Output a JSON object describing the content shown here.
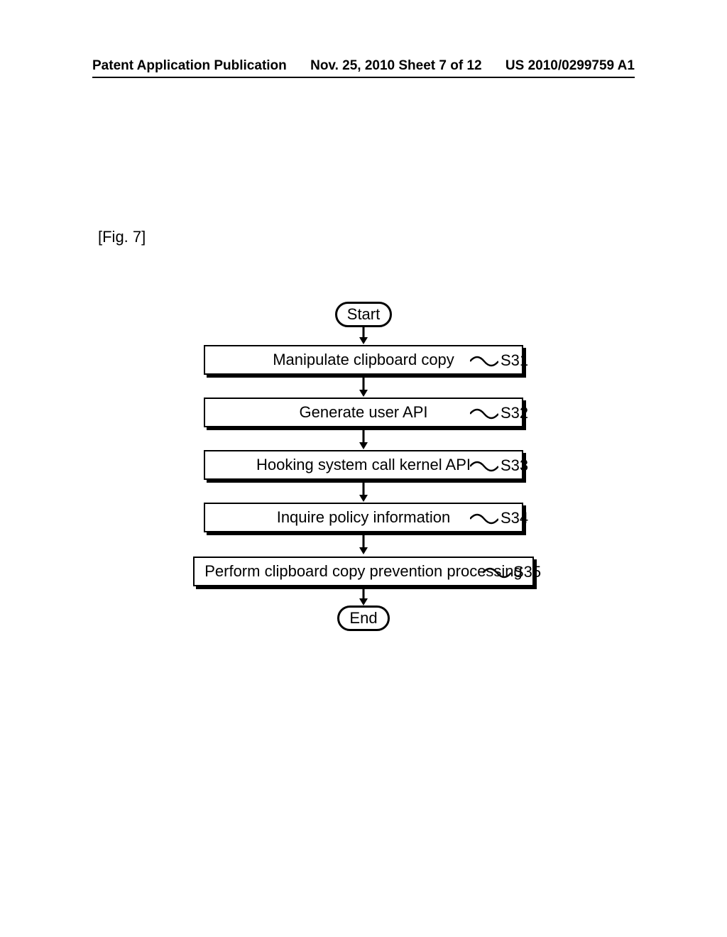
{
  "header": {
    "left": "Patent Application Publication",
    "center": "Nov. 25, 2010  Sheet 7 of 12",
    "right": "US 2010/0299759 A1"
  },
  "figure": {
    "label": "[Fig. 7]"
  },
  "chart_data": {
    "type": "flowchart",
    "title": "Fig. 7",
    "nodes": [
      {
        "id": "start",
        "shape": "terminal",
        "label": "Start"
      },
      {
        "id": "S31",
        "shape": "process",
        "label": "Manipulate clipboard copy",
        "step": "S31"
      },
      {
        "id": "S32",
        "shape": "process",
        "label": "Generate user API",
        "step": "S32"
      },
      {
        "id": "S33",
        "shape": "process",
        "label": "Hooking system call kernel API",
        "step": "S33"
      },
      {
        "id": "S34",
        "shape": "process",
        "label": "Inquire policy information",
        "step": "S34"
      },
      {
        "id": "S35",
        "shape": "process",
        "label": "Perform clipboard copy prevention processing",
        "step": "S35"
      },
      {
        "id": "end",
        "shape": "terminal",
        "label": "End"
      }
    ],
    "edges": [
      [
        "start",
        "S31"
      ],
      [
        "S31",
        "S32"
      ],
      [
        "S32",
        "S33"
      ],
      [
        "S33",
        "S34"
      ],
      [
        "S34",
        "S35"
      ],
      [
        "S35",
        "end"
      ]
    ]
  }
}
